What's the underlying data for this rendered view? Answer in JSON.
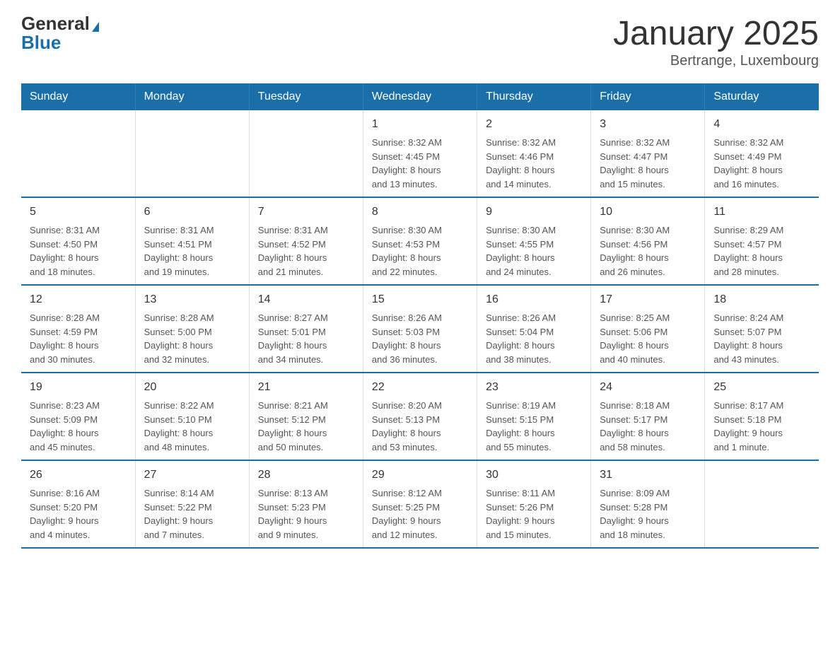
{
  "logo": {
    "general": "General",
    "blue": "Blue"
  },
  "title": "January 2025",
  "subtitle": "Bertrange, Luxembourg",
  "days_of_week": [
    "Sunday",
    "Monday",
    "Tuesday",
    "Wednesday",
    "Thursday",
    "Friday",
    "Saturday"
  ],
  "weeks": [
    [
      {
        "day": "",
        "info": ""
      },
      {
        "day": "",
        "info": ""
      },
      {
        "day": "",
        "info": ""
      },
      {
        "day": "1",
        "info": "Sunrise: 8:32 AM\nSunset: 4:45 PM\nDaylight: 8 hours\nand 13 minutes."
      },
      {
        "day": "2",
        "info": "Sunrise: 8:32 AM\nSunset: 4:46 PM\nDaylight: 8 hours\nand 14 minutes."
      },
      {
        "day": "3",
        "info": "Sunrise: 8:32 AM\nSunset: 4:47 PM\nDaylight: 8 hours\nand 15 minutes."
      },
      {
        "day": "4",
        "info": "Sunrise: 8:32 AM\nSunset: 4:49 PM\nDaylight: 8 hours\nand 16 minutes."
      }
    ],
    [
      {
        "day": "5",
        "info": "Sunrise: 8:31 AM\nSunset: 4:50 PM\nDaylight: 8 hours\nand 18 minutes."
      },
      {
        "day": "6",
        "info": "Sunrise: 8:31 AM\nSunset: 4:51 PM\nDaylight: 8 hours\nand 19 minutes."
      },
      {
        "day": "7",
        "info": "Sunrise: 8:31 AM\nSunset: 4:52 PM\nDaylight: 8 hours\nand 21 minutes."
      },
      {
        "day": "8",
        "info": "Sunrise: 8:30 AM\nSunset: 4:53 PM\nDaylight: 8 hours\nand 22 minutes."
      },
      {
        "day": "9",
        "info": "Sunrise: 8:30 AM\nSunset: 4:55 PM\nDaylight: 8 hours\nand 24 minutes."
      },
      {
        "day": "10",
        "info": "Sunrise: 8:30 AM\nSunset: 4:56 PM\nDaylight: 8 hours\nand 26 minutes."
      },
      {
        "day": "11",
        "info": "Sunrise: 8:29 AM\nSunset: 4:57 PM\nDaylight: 8 hours\nand 28 minutes."
      }
    ],
    [
      {
        "day": "12",
        "info": "Sunrise: 8:28 AM\nSunset: 4:59 PM\nDaylight: 8 hours\nand 30 minutes."
      },
      {
        "day": "13",
        "info": "Sunrise: 8:28 AM\nSunset: 5:00 PM\nDaylight: 8 hours\nand 32 minutes."
      },
      {
        "day": "14",
        "info": "Sunrise: 8:27 AM\nSunset: 5:01 PM\nDaylight: 8 hours\nand 34 minutes."
      },
      {
        "day": "15",
        "info": "Sunrise: 8:26 AM\nSunset: 5:03 PM\nDaylight: 8 hours\nand 36 minutes."
      },
      {
        "day": "16",
        "info": "Sunrise: 8:26 AM\nSunset: 5:04 PM\nDaylight: 8 hours\nand 38 minutes."
      },
      {
        "day": "17",
        "info": "Sunrise: 8:25 AM\nSunset: 5:06 PM\nDaylight: 8 hours\nand 40 minutes."
      },
      {
        "day": "18",
        "info": "Sunrise: 8:24 AM\nSunset: 5:07 PM\nDaylight: 8 hours\nand 43 minutes."
      }
    ],
    [
      {
        "day": "19",
        "info": "Sunrise: 8:23 AM\nSunset: 5:09 PM\nDaylight: 8 hours\nand 45 minutes."
      },
      {
        "day": "20",
        "info": "Sunrise: 8:22 AM\nSunset: 5:10 PM\nDaylight: 8 hours\nand 48 minutes."
      },
      {
        "day": "21",
        "info": "Sunrise: 8:21 AM\nSunset: 5:12 PM\nDaylight: 8 hours\nand 50 minutes."
      },
      {
        "day": "22",
        "info": "Sunrise: 8:20 AM\nSunset: 5:13 PM\nDaylight: 8 hours\nand 53 minutes."
      },
      {
        "day": "23",
        "info": "Sunrise: 8:19 AM\nSunset: 5:15 PM\nDaylight: 8 hours\nand 55 minutes."
      },
      {
        "day": "24",
        "info": "Sunrise: 8:18 AM\nSunset: 5:17 PM\nDaylight: 8 hours\nand 58 minutes."
      },
      {
        "day": "25",
        "info": "Sunrise: 8:17 AM\nSunset: 5:18 PM\nDaylight: 9 hours\nand 1 minute."
      }
    ],
    [
      {
        "day": "26",
        "info": "Sunrise: 8:16 AM\nSunset: 5:20 PM\nDaylight: 9 hours\nand 4 minutes."
      },
      {
        "day": "27",
        "info": "Sunrise: 8:14 AM\nSunset: 5:22 PM\nDaylight: 9 hours\nand 7 minutes."
      },
      {
        "day": "28",
        "info": "Sunrise: 8:13 AM\nSunset: 5:23 PM\nDaylight: 9 hours\nand 9 minutes."
      },
      {
        "day": "29",
        "info": "Sunrise: 8:12 AM\nSunset: 5:25 PM\nDaylight: 9 hours\nand 12 minutes."
      },
      {
        "day": "30",
        "info": "Sunrise: 8:11 AM\nSunset: 5:26 PM\nDaylight: 9 hours\nand 15 minutes."
      },
      {
        "day": "31",
        "info": "Sunrise: 8:09 AM\nSunset: 5:28 PM\nDaylight: 9 hours\nand 18 minutes."
      },
      {
        "day": "",
        "info": ""
      }
    ]
  ]
}
